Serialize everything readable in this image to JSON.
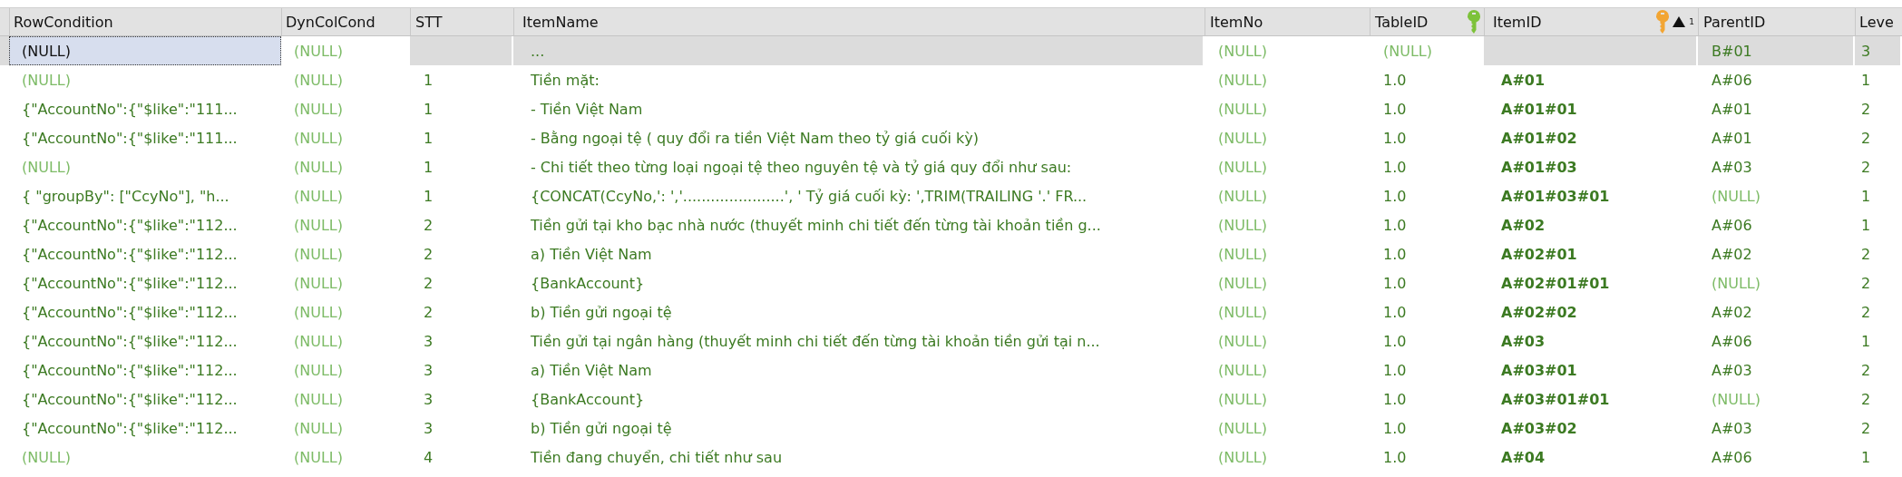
{
  "columns": [
    {
      "label": "RowCondition",
      "kind": "plain",
      "bold": false
    },
    {
      "label": "DynColCond",
      "kind": "plain",
      "bold": false
    },
    {
      "label": "STT",
      "kind": "plain",
      "bold": false
    },
    {
      "label": "ItemName",
      "kind": "plain",
      "bold": false
    },
    {
      "label": "ItemNo",
      "kind": "plain",
      "bold": false
    },
    {
      "label": "TableID",
      "kind": "key",
      "color": "#7dc23a",
      "bold": false
    },
    {
      "label": "ItemID",
      "kind": "sorted_key",
      "color": "#f2a533",
      "sort_index": "1",
      "bold": true
    },
    {
      "label": "ParentID",
      "kind": "plain",
      "bold": false
    },
    {
      "label": "Leve",
      "kind": "plain",
      "bold": false
    }
  ],
  "rows": [
    {
      "selected": true,
      "cells": [
        {
          "text": "(NULL)",
          "null": true,
          "focused": true,
          "shaded": false
        },
        {
          "text": "(NULL)",
          "null": true,
          "focused": false,
          "shaded": false
        },
        {
          "focused": false,
          "shaded": true
        },
        {
          "text": "...",
          "null": false,
          "focused": false,
          "shaded": true
        },
        {
          "text": "(NULL)",
          "null": true,
          "focused": false,
          "shaded": false
        },
        {
          "text": "(NULL)",
          "null": true,
          "focused": false,
          "shaded": false
        },
        {
          "focused": false,
          "shaded": true
        },
        {
          "text": "B#01",
          "null": false,
          "focused": false,
          "shaded": true
        },
        {
          "text": "3",
          "null": false,
          "focused": false,
          "shaded": true
        }
      ]
    },
    {
      "selected": false,
      "cells": [
        {
          "text": "(NULL)",
          "null": true
        },
        {
          "text": "(NULL)",
          "null": true
        },
        {
          "text": "1",
          "null": false
        },
        {
          "text": "Tiền mặt:",
          "null": false
        },
        {
          "text": "(NULL)",
          "null": true
        },
        {
          "text": "1.0",
          "null": false
        },
        {
          "text": "A#01",
          "null": false
        },
        {
          "text": "A#06",
          "null": false
        },
        {
          "text": "1",
          "null": false
        }
      ]
    },
    {
      "selected": false,
      "cells": [
        {
          "text": "{\"AccountNo\":{\"$like\":\"111...",
          "null": false
        },
        {
          "text": "(NULL)",
          "null": true
        },
        {
          "text": "1",
          "null": false
        },
        {
          "text": "- Tiền Việt Nam",
          "null": false
        },
        {
          "text": "(NULL)",
          "null": true
        },
        {
          "text": "1.0",
          "null": false
        },
        {
          "text": "A#01#01",
          "null": false
        },
        {
          "text": "A#01",
          "null": false
        },
        {
          "text": "2",
          "null": false
        }
      ]
    },
    {
      "selected": false,
      "cells": [
        {
          "text": "{\"AccountNo\":{\"$like\":\"111...",
          "null": false
        },
        {
          "text": "(NULL)",
          "null": true
        },
        {
          "text": "1",
          "null": false
        },
        {
          "text": "- Bằng ngoại tệ ( quy đổi ra tiền Việt Nam theo tỷ giá cuối kỳ)",
          "null": false
        },
        {
          "text": "(NULL)",
          "null": true
        },
        {
          "text": "1.0",
          "null": false
        },
        {
          "text": "A#01#02",
          "null": false
        },
        {
          "text": "A#01",
          "null": false
        },
        {
          "text": "2",
          "null": false
        }
      ]
    },
    {
      "selected": false,
      "cells": [
        {
          "text": "(NULL)",
          "null": true
        },
        {
          "text": "(NULL)",
          "null": true
        },
        {
          "text": "1",
          "null": false
        },
        {
          "text": "- Chi tiết theo từng loại ngoại tệ theo nguyên tệ và tỷ giá quy đổi như sau:",
          "null": false
        },
        {
          "text": "(NULL)",
          "null": true
        },
        {
          "text": "1.0",
          "null": false
        },
        {
          "text": "A#01#03",
          "null": false
        },
        {
          "text": "A#03",
          "null": false
        },
        {
          "text": "2",
          "null": false
        }
      ]
    },
    {
      "selected": false,
      "cells": [
        {
          "text": "{ \"groupBy\": [\"CcyNo\"], \"h...",
          "null": false
        },
        {
          "text": "(NULL)",
          "null": true
        },
        {
          "text": "1",
          "null": false
        },
        {
          "text": "{CONCAT(CcyNo,': ','......................', ' Tỷ giá cuối kỳ:  ',TRIM(TRAILING '.' FR...",
          "null": false
        },
        {
          "text": "(NULL)",
          "null": true
        },
        {
          "text": "1.0",
          "null": false
        },
        {
          "text": "A#01#03#01",
          "null": false
        },
        {
          "text": "(NULL)",
          "null": true
        },
        {
          "text": "1",
          "null": false
        }
      ]
    },
    {
      "selected": false,
      "cells": [
        {
          "text": "{\"AccountNo\":{\"$like\":\"112...",
          "null": false
        },
        {
          "text": "(NULL)",
          "null": true
        },
        {
          "text": "2",
          "null": false
        },
        {
          "text": "Tiền gửi tại kho bạc nhà nước (thuyết minh chi tiết đến từng tài khoản tiền g...",
          "null": false
        },
        {
          "text": "(NULL)",
          "null": true
        },
        {
          "text": "1.0",
          "null": false
        },
        {
          "text": "A#02",
          "null": false
        },
        {
          "text": "A#06",
          "null": false
        },
        {
          "text": "1",
          "null": false
        }
      ]
    },
    {
      "selected": false,
      "cells": [
        {
          "text": "{\"AccountNo\":{\"$like\":\"112...",
          "null": false
        },
        {
          "text": "(NULL)",
          "null": true
        },
        {
          "text": "2",
          "null": false
        },
        {
          "text": "a) Tiền Việt Nam",
          "null": false
        },
        {
          "text": "(NULL)",
          "null": true
        },
        {
          "text": "1.0",
          "null": false
        },
        {
          "text": "A#02#01",
          "null": false
        },
        {
          "text": "A#02",
          "null": false
        },
        {
          "text": "2",
          "null": false
        }
      ]
    },
    {
      "selected": false,
      "cells": [
        {
          "text": "{\"AccountNo\":{\"$like\":\"112...",
          "null": false
        },
        {
          "text": "(NULL)",
          "null": true
        },
        {
          "text": "2",
          "null": false
        },
        {
          "text": "{BankAccount}",
          "null": false
        },
        {
          "text": "(NULL)",
          "null": true
        },
        {
          "text": "1.0",
          "null": false
        },
        {
          "text": "A#02#01#01",
          "null": false
        },
        {
          "text": "(NULL)",
          "null": true
        },
        {
          "text": "2",
          "null": false
        }
      ]
    },
    {
      "selected": false,
      "cells": [
        {
          "text": "{\"AccountNo\":{\"$like\":\"112...",
          "null": false
        },
        {
          "text": "(NULL)",
          "null": true
        },
        {
          "text": "2",
          "null": false
        },
        {
          "text": "b) Tiền gửi ngoại tệ",
          "null": false
        },
        {
          "text": "(NULL)",
          "null": true
        },
        {
          "text": "1.0",
          "null": false
        },
        {
          "text": "A#02#02",
          "null": false
        },
        {
          "text": "A#02",
          "null": false
        },
        {
          "text": "2",
          "null": false
        }
      ]
    },
    {
      "selected": false,
      "cells": [
        {
          "text": "{\"AccountNo\":{\"$like\":\"112...",
          "null": false
        },
        {
          "text": "(NULL)",
          "null": true
        },
        {
          "text": "3",
          "null": false
        },
        {
          "text": "Tiền gửi tại ngân hàng (thuyết minh chi tiết đến từng tài khoản tiền gửi tại n...",
          "null": false
        },
        {
          "text": "(NULL)",
          "null": true
        },
        {
          "text": "1.0",
          "null": false
        },
        {
          "text": "A#03",
          "null": false
        },
        {
          "text": "A#06",
          "null": false
        },
        {
          "text": "1",
          "null": false
        }
      ]
    },
    {
      "selected": false,
      "cells": [
        {
          "text": "{\"AccountNo\":{\"$like\":\"112...",
          "null": false
        },
        {
          "text": "(NULL)",
          "null": true
        },
        {
          "text": "3",
          "null": false
        },
        {
          "text": "a) Tiền Việt Nam",
          "null": false
        },
        {
          "text": "(NULL)",
          "null": true
        },
        {
          "text": "1.0",
          "null": false
        },
        {
          "text": "A#03#01",
          "null": false
        },
        {
          "text": "A#03",
          "null": false
        },
        {
          "text": "2",
          "null": false
        }
      ]
    },
    {
      "selected": false,
      "cells": [
        {
          "text": "{\"AccountNo\":{\"$like\":\"112...",
          "null": false
        },
        {
          "text": "(NULL)",
          "null": true
        },
        {
          "text": "3",
          "null": false
        },
        {
          "text": "{BankAccount}",
          "null": false
        },
        {
          "text": "(NULL)",
          "null": true
        },
        {
          "text": "1.0",
          "null": false
        },
        {
          "text": "A#03#01#01",
          "null": false
        },
        {
          "text": "(NULL)",
          "null": true
        },
        {
          "text": "2",
          "null": false
        }
      ]
    },
    {
      "selected": false,
      "cells": [
        {
          "text": "{\"AccountNo\":{\"$like\":\"112...",
          "null": false
        },
        {
          "text": "(NULL)",
          "null": true
        },
        {
          "text": "3",
          "null": false
        },
        {
          "text": "b) Tiền gửi ngoại tệ",
          "null": false
        },
        {
          "text": "(NULL)",
          "null": true
        },
        {
          "text": "1.0",
          "null": false
        },
        {
          "text": "A#03#02",
          "null": false
        },
        {
          "text": "A#03",
          "null": false
        },
        {
          "text": "2",
          "null": false
        }
      ]
    },
    {
      "selected": false,
      "cells": [
        {
          "text": "(NULL)",
          "null": true
        },
        {
          "text": "(NULL)",
          "null": true
        },
        {
          "text": "4",
          "null": false
        },
        {
          "text": "Tiền đang chuyển, chi tiết như sau",
          "null": false
        },
        {
          "text": "(NULL)",
          "null": true
        },
        {
          "text": "1.0",
          "null": false
        },
        {
          "text": "A#04",
          "null": false
        },
        {
          "text": "A#06",
          "null": false
        },
        {
          "text": "1",
          "null": false
        }
      ]
    }
  ]
}
